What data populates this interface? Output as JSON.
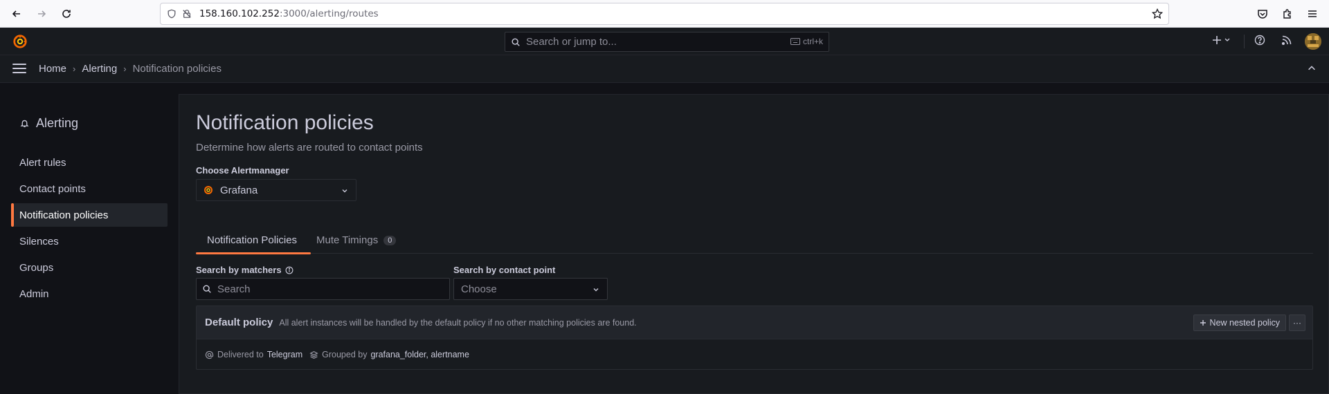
{
  "browser": {
    "url_host": "158.160.102.252",
    "url_path": ":3000/alerting/routes"
  },
  "topbar": {
    "search_placeholder": "Search or jump to...",
    "search_shortcut": "ctrl+k"
  },
  "breadcrumb": {
    "items": [
      "Home",
      "Alerting",
      "Notification policies"
    ]
  },
  "sidebar": {
    "title": "Alerting",
    "items": [
      {
        "label": "Alert rules"
      },
      {
        "label": "Contact points"
      },
      {
        "label": "Notification policies",
        "active": true
      },
      {
        "label": "Silences"
      },
      {
        "label": "Groups"
      },
      {
        "label": "Admin"
      }
    ]
  },
  "page": {
    "title": "Notification policies",
    "subtitle": "Determine how alerts are routed to contact points",
    "alertmanager_label": "Choose Alertmanager",
    "alertmanager_value": "Grafana"
  },
  "tabs": [
    {
      "label": "Notification Policies",
      "active": true
    },
    {
      "label": "Mute Timings",
      "count": "0"
    }
  ],
  "filters": {
    "matchers_label": "Search by matchers",
    "matchers_placeholder": "Search",
    "contact_label": "Search by contact point",
    "contact_value": "Choose"
  },
  "policy": {
    "title": "Default policy",
    "description": "All alert instances will be handled by the default policy if no other matching policies are found.",
    "new_nested_label": "New nested policy",
    "more_label": "···",
    "delivered_prefix": "Delivered to",
    "delivered_value": "Telegram",
    "grouped_prefix": "Grouped by",
    "grouped_value": "grafana_folder, alertname"
  },
  "colors": {
    "accent": "#ff7941",
    "background": "#111217",
    "panel": "#181b1f"
  }
}
